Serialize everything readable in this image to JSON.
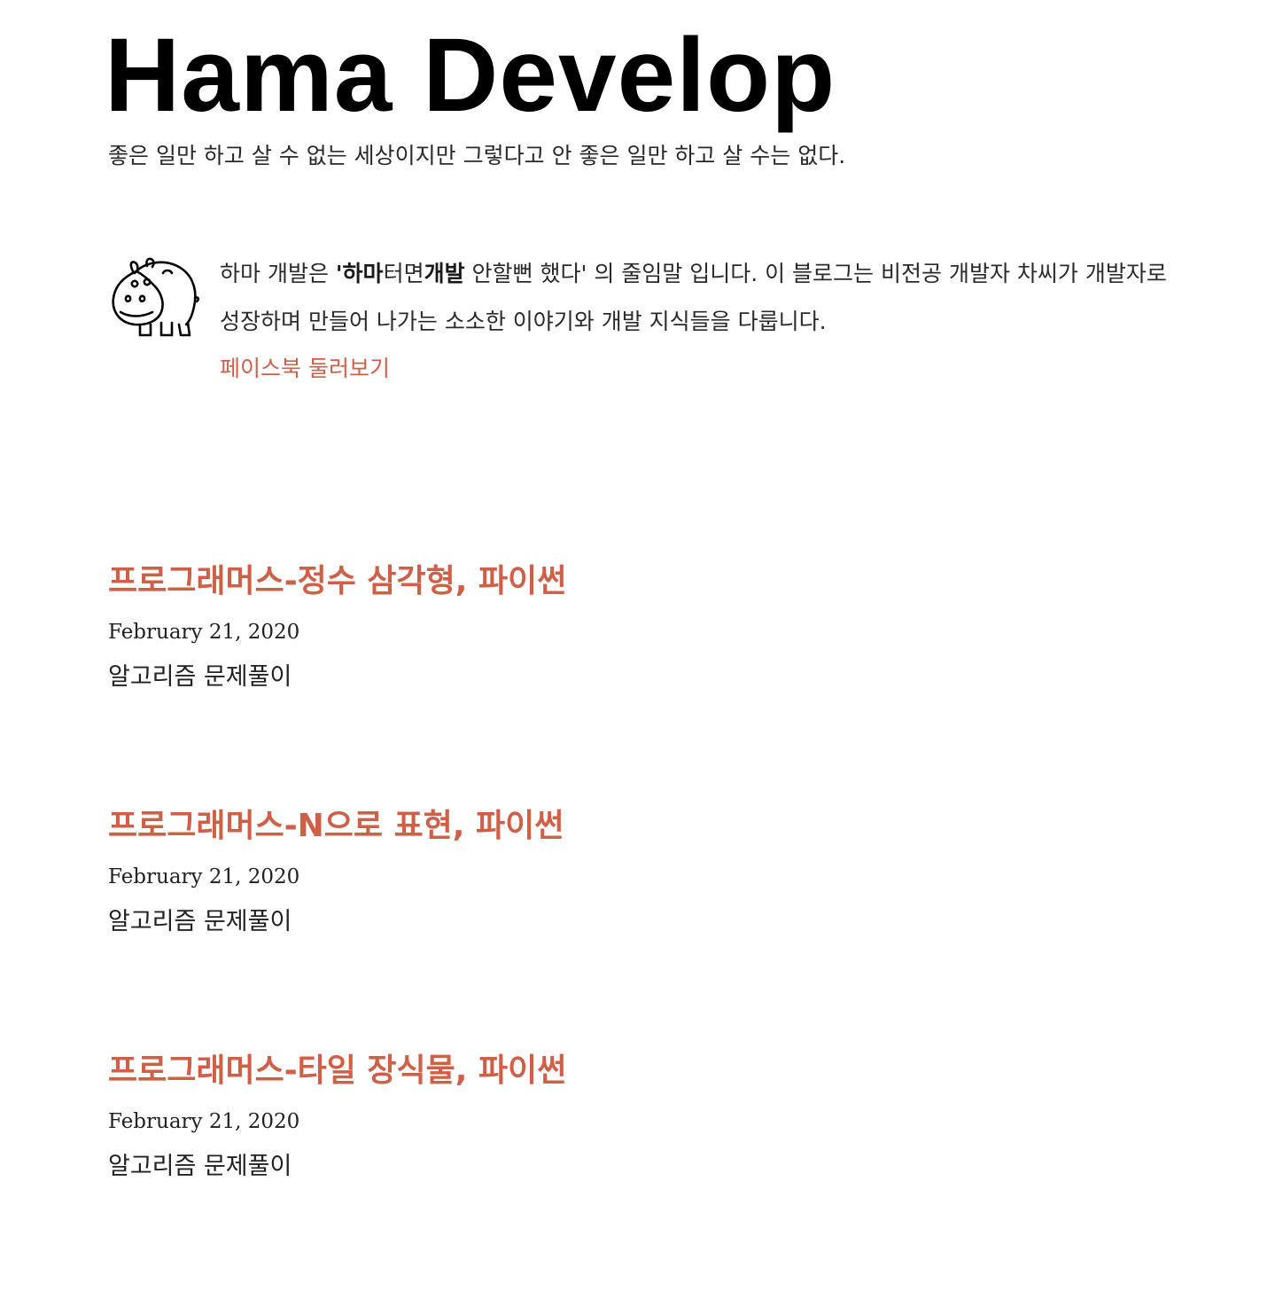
{
  "header": {
    "title": "Hama Develop",
    "tagline": "좋은 일만 하고 살 수 없는 세상이지만 그렇다고 안 좋은 일만 하고 살 수는 없다."
  },
  "bio": {
    "avatar_icon": "hippo-icon",
    "text_1": "하마 개발은 ",
    "text_2": "'하마",
    "text_3": "터면",
    "text_4": "개발",
    "text_5": " 안할뻔 했다'",
    "text_6": " 의 줄임말 입니다. 이 블로그는 비전공 개발자 차씨가 개발자로 성장하며 만들어 나가는 소소한 이야기와 개발 지식들을 다룹니다.",
    "link_label": "페이스북 둘러보기"
  },
  "posts": [
    {
      "title": "프로그래머스-정수 삼각형, 파이썬",
      "date": "February 21, 2020",
      "description": "알고리즘 문제풀이"
    },
    {
      "title": "프로그래머스-N으로 표현, 파이썬",
      "date": "February 21, 2020",
      "description": "알고리즘 문제풀이"
    },
    {
      "title": "프로그래머스-타일 장식물, 파이썬",
      "date": "February 21, 2020",
      "description": "알고리즘 문제풀이"
    }
  ],
  "colors": {
    "accent": "#d05f48",
    "text": "#222222",
    "title": "#000000"
  }
}
